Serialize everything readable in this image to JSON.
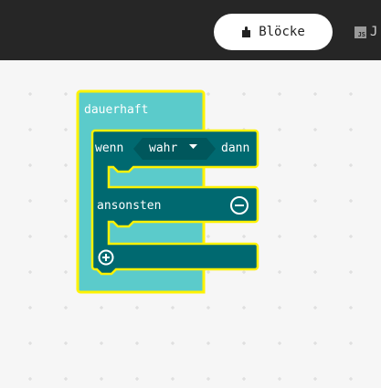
{
  "toolbar": {
    "blocks_tab_label": "Blöcke",
    "javascript_tab_label": "J",
    "javascript_badge": "JS"
  },
  "blocks": {
    "forever_label": "dauerhaft",
    "if_label": "wenn",
    "condition_value": "wahr",
    "then_label": "dann",
    "else_label": "ansonsten"
  },
  "colors": {
    "topbar": "#262626",
    "forever_block": "#5BCBCB",
    "logic_block": "#006970",
    "condition_block": "#00575C",
    "selection_outline": "#FFF200",
    "workspace": "#F6F6F6",
    "grid": "#D8D8D8"
  },
  "icons": {
    "blocks_tab": "puzzle-icon",
    "condition_dropdown": "dropdown-triangle-icon",
    "remove_else": "minus-circle-icon",
    "add_branch": "plus-circle-icon"
  }
}
